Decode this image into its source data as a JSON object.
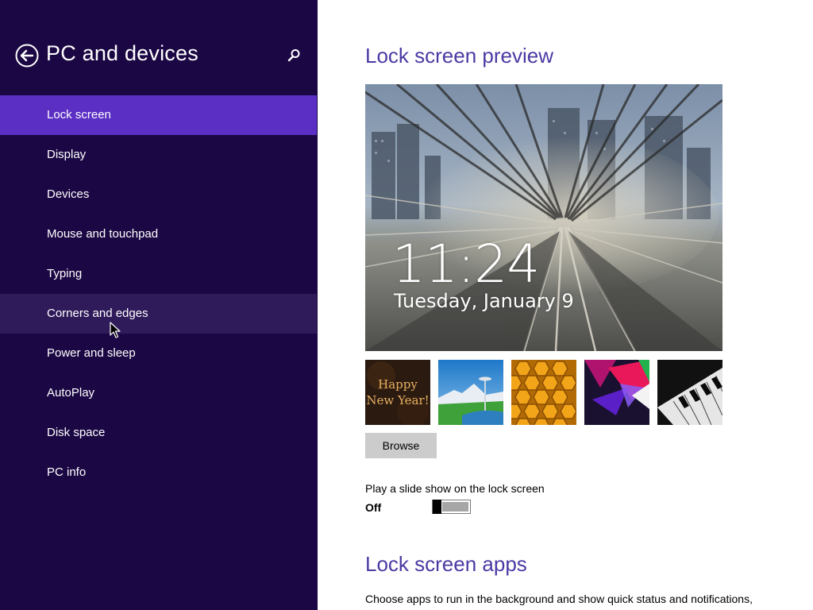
{
  "sidebar": {
    "title": "PC and devices",
    "items": [
      {
        "label": "Lock screen",
        "state": "selected"
      },
      {
        "label": "Display",
        "state": "normal"
      },
      {
        "label": "Devices",
        "state": "normal"
      },
      {
        "label": "Mouse and touchpad",
        "state": "normal"
      },
      {
        "label": "Typing",
        "state": "normal"
      },
      {
        "label": "Corners and edges",
        "state": "hover"
      },
      {
        "label": "Power and sleep",
        "state": "normal"
      },
      {
        "label": "AutoPlay",
        "state": "normal"
      },
      {
        "label": "Disk space",
        "state": "normal"
      },
      {
        "label": "PC info",
        "state": "normal"
      }
    ],
    "colors": {
      "background": "#1b0743",
      "selected": "#5b2fc4",
      "hover": "#2f1a5a"
    }
  },
  "main": {
    "preview_heading": "Lock screen preview",
    "preview": {
      "time": "11:24",
      "date": "Tuesday, January 9"
    },
    "thumbnails": [
      {
        "name": "happy-new-year",
        "text_line1": "Happy",
        "text_line2": "New Year!"
      },
      {
        "name": "space-needle"
      },
      {
        "name": "honeycomb"
      },
      {
        "name": "colorful-shapes"
      },
      {
        "name": "piano-keys"
      }
    ],
    "browse_label": "Browse",
    "slideshow": {
      "label": "Play a slide show on the lock screen",
      "state": "Off"
    },
    "apps_heading": "Lock screen apps",
    "apps_description": "Choose apps to run in the background and show quick status and notifications,",
    "colors": {
      "heading": "#4a3aa3"
    }
  }
}
